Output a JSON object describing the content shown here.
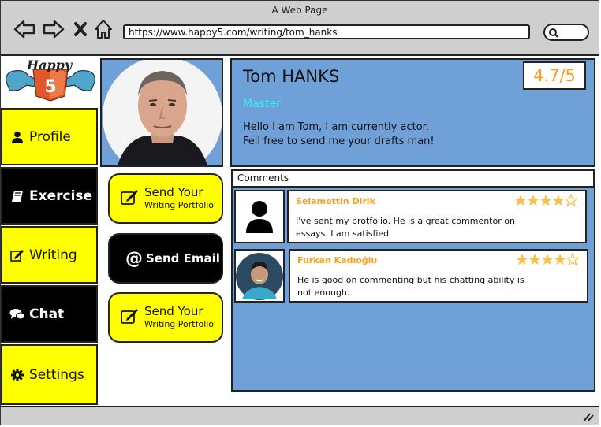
{
  "window": {
    "title": "A Web Page"
  },
  "browser": {
    "url": "https://www.happy5.com/writing/tom_hanks"
  },
  "logo": {
    "text": "Happy",
    "badge": "5"
  },
  "sidebar": {
    "items": [
      {
        "label": "Profile",
        "icon": "user-icon",
        "style": "yellow"
      },
      {
        "label": "Exercise",
        "icon": "book-icon",
        "style": "black"
      },
      {
        "label": "Writing",
        "icon": "edit-icon",
        "style": "yellow"
      },
      {
        "label": "Chat",
        "icon": "chat-icon",
        "style": "black"
      },
      {
        "label": "Settings",
        "icon": "gear-icon",
        "style": "yellow"
      }
    ]
  },
  "actions": {
    "send_portfolio_1": {
      "line1": "Send Your",
      "line2": "Writing Portfolio"
    },
    "send_email": {
      "label": "Send Email"
    },
    "send_portfolio_2": {
      "line1": "Send Your",
      "line2": "Writing Portfolio"
    }
  },
  "profile": {
    "name": "Tom HANKS",
    "rating": "4.7/5",
    "level": "Master",
    "bio_line1": "Hello I am Tom, I am currently actor.",
    "bio_line2": "Fell free to send me your drafts man!"
  },
  "comments": {
    "title": "Comments",
    "items": [
      {
        "author": "Selamettin Dirik",
        "stars": 4.5,
        "text": "I've sent my protfolio. He is a great commentor on essays. I am satisfied."
      },
      {
        "author": "Furkan Kadıoğlu",
        "stars": 4,
        "text": "He is good on commenting but his chatting ability is not enough."
      }
    ]
  },
  "colors": {
    "accent_yellow": "#ffff00",
    "panel_blue": "#6fa0d8",
    "rating_orange": "#f7a01e",
    "level_cyan": "#39f0ff"
  }
}
